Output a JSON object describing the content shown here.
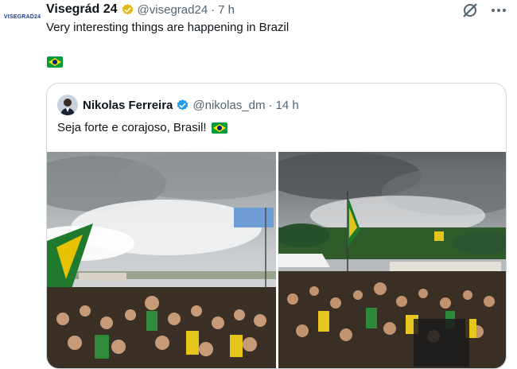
{
  "tweet": {
    "author_name": "Visegrád 24",
    "handle": "@visegrad24",
    "separator": "·",
    "time": "7 h",
    "avatar_text": "VISEGRAD24",
    "text": "Very interesting things are happening in Brazil",
    "flag_emoji": "brazil-flag-emoji",
    "verified_badge": "gold-verified-icon"
  },
  "quoted": {
    "author_name": "Nikolas Ferreira",
    "handle": "@nikolas_dm",
    "separator": "·",
    "time": "14 h",
    "text": "Seja forte e corajoso, Brasil!",
    "verified_badge": "blue-verified-icon",
    "images": [
      "crowd-photo-left",
      "crowd-photo-right"
    ]
  },
  "icons": {
    "grok": "grok-icon",
    "more": "more-options-icon"
  },
  "colors": {
    "text": "#0f1419",
    "muted": "#536471",
    "border": "#cfd9de",
    "gold_badge": "#e2b719",
    "blue_badge": "#1d9bf0",
    "flag_green": "#009c3b",
    "flag_yellow": "#ffdf00",
    "flag_blue": "#002776"
  }
}
